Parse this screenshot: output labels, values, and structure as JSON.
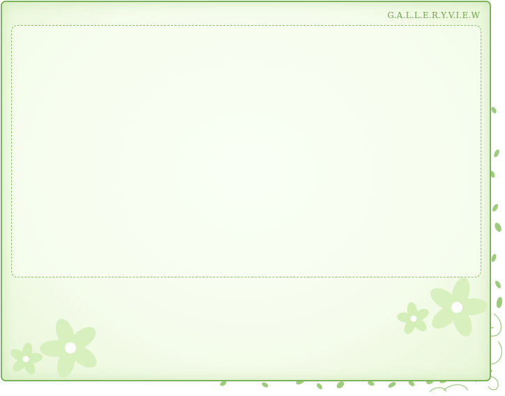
{
  "gallery": {
    "title": "G.A.L.L.E.R.Y.V.I.E.W"
  },
  "colors": {
    "frame_border": "#7cb35a",
    "title_text": "#6fa74a",
    "viewport_dash": "#8cc16a",
    "background": "#f5fcec",
    "flower_fill": "#d7f0bd",
    "leaf_fill": "#8bc466"
  },
  "icons": {
    "flower": "flower-icon",
    "vine": "vine-icon",
    "leaf": "leaf-icon"
  }
}
